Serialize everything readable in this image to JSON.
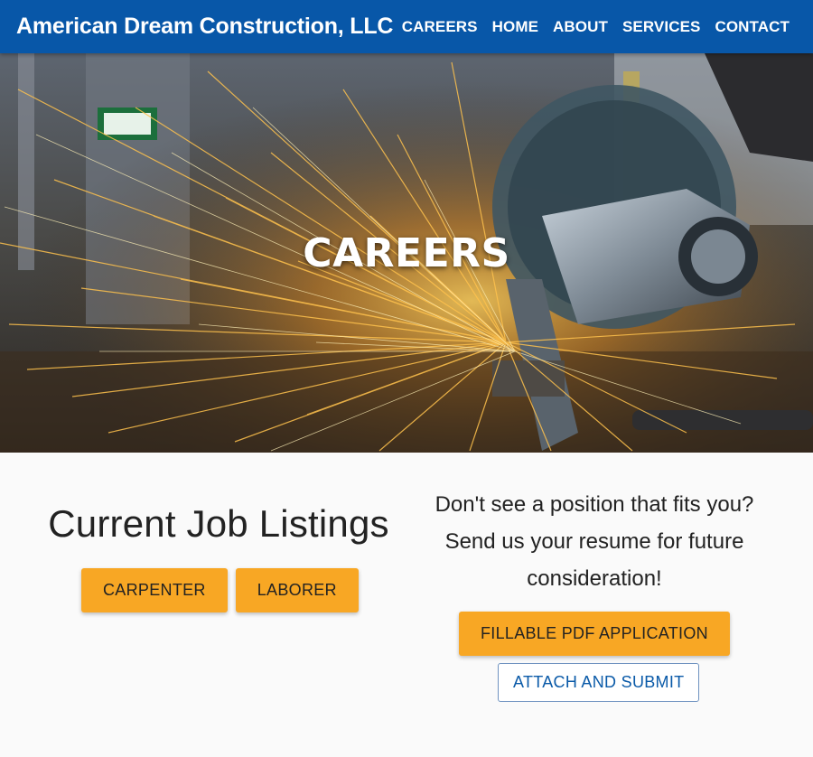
{
  "header": {
    "brand": "American Dream Construction, LLC",
    "nav": [
      "CAREERS",
      "HOME",
      "ABOUT",
      "SERVICES",
      "CONTACT"
    ]
  },
  "hero": {
    "title": "CAREERS",
    "image": "sparks-angle-grinder-photo"
  },
  "listings": {
    "heading": "Current Job Listings",
    "jobs": [
      "CARPENTER",
      "LABORER"
    ]
  },
  "apply": {
    "message_lines": [
      "Don't see a position that fits you?",
      "Send us your resume for future",
      "consideration!"
    ],
    "pdf_button": "FILLABLE PDF APPLICATION",
    "attach_button": "ATTACH AND SUBMIT"
  },
  "colors": {
    "header_bg": "#0857a8",
    "accent": "#f8a724",
    "page_bg": "#fafafa"
  }
}
